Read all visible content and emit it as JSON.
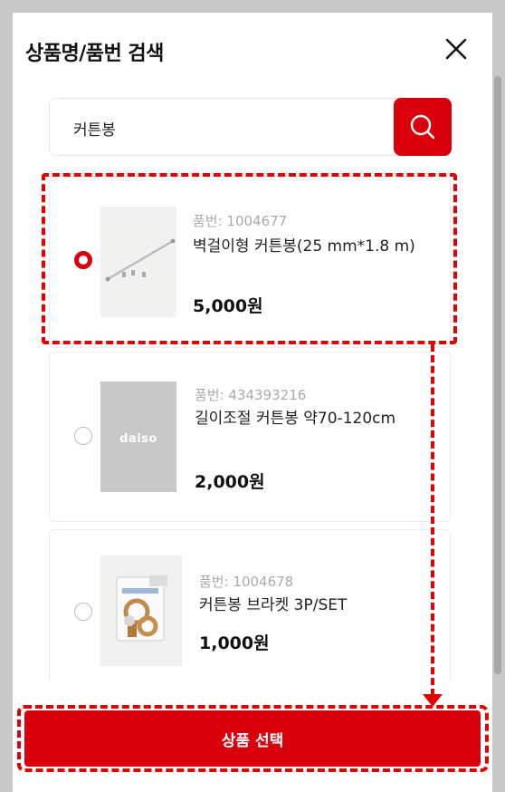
{
  "modal": {
    "title": "상품명/품번 검색",
    "close_icon": "close-icon"
  },
  "search": {
    "value": "커튼봉",
    "icon": "search-icon"
  },
  "products": [
    {
      "code_label": "품번: 1004677",
      "name": "벽걸이형 커튼봉(25 mm*1.8 m)",
      "price": "5,000원",
      "selected": true,
      "thumbnail": "curtain-rod-image"
    },
    {
      "code_label": "품번: 434393216",
      "name": "길이조절 커튼봉 약70-120cm",
      "price": "2,000원",
      "selected": false,
      "thumbnail": "daiso-placeholder-image",
      "thumbnail_text": "daiso"
    },
    {
      "code_label": "품번: 1004678",
      "name": "커튼봉 브라켓 3P/SET",
      "price": "1,000원",
      "selected": false,
      "thumbnail": "bracket-image"
    }
  ],
  "footer": {
    "select_label": "상품 선택"
  },
  "colors": {
    "accent": "#d9000b",
    "annotation": "#e30000",
    "backdrop": "#c8c8c8"
  }
}
